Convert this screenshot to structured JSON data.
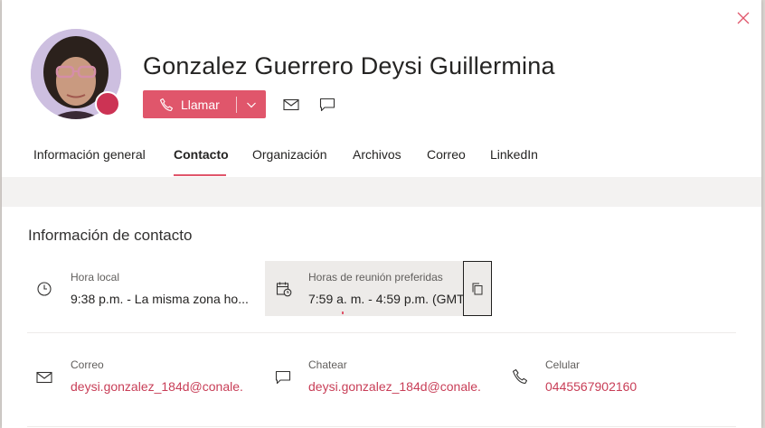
{
  "profile": {
    "name": "Gonzalez Guerrero Deysi Guillermina",
    "presence_color": "#cc3354",
    "avatar_icon": "profile-photo"
  },
  "actions": {
    "call_label": "Llamar",
    "call_icon": "phone-icon",
    "dropdown_icon": "chevron-down-icon",
    "mail_icon": "mail-icon",
    "chat_icon": "chat-icon"
  },
  "tabs": [
    {
      "label": "Información general",
      "active": false
    },
    {
      "label": "Contacto",
      "active": true
    },
    {
      "label": "Organización",
      "active": false
    },
    {
      "label": "Archivos",
      "active": false
    },
    {
      "label": "Correo",
      "active": false
    },
    {
      "label": "LinkedIn",
      "active": false
    }
  ],
  "contact": {
    "section_title": "Información de contacto",
    "local_time": {
      "label": "Hora local",
      "value": "9:38 p.m. - La misma zona ho...",
      "icon": "clock-icon"
    },
    "meeting_hours": {
      "label": "Horas de reunión preferidas",
      "value": "7:59 a. m. - 4:59 p.m. (GMT-",
      "icon": "calendar-clock-icon",
      "copy_icon": "copy-icon"
    },
    "email": {
      "label": "Correo",
      "value": "deysi.gonzalez_184d@conale...",
      "icon": "mail-icon"
    },
    "chat": {
      "label": "Chatear",
      "value": "deysi.gonzalez_184d@conale...",
      "icon": "chat-icon"
    },
    "mobile": {
      "label": "Celular",
      "value": "0445567902160",
      "icon": "phone-icon"
    }
  },
  "colors": {
    "accent": "#e0566b",
    "link": "#c83e57"
  }
}
